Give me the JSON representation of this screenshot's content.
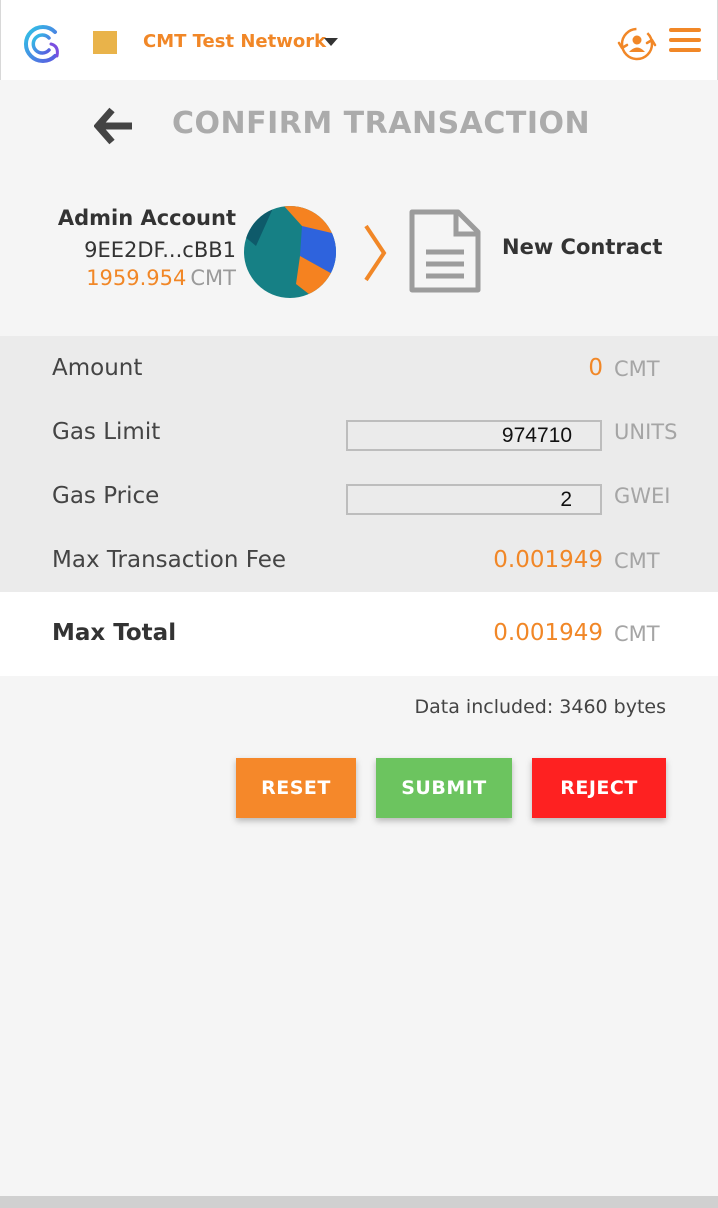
{
  "header": {
    "network_name": "CMT Test Network",
    "network_color": "#e9b34a",
    "accent": "#f18727"
  },
  "page": {
    "title": "CONFIRM TRANSACTION"
  },
  "sender": {
    "name": "Admin Account",
    "address": "9EE2DF...cBB1",
    "balance": "1959.954",
    "balance_unit": "CMT"
  },
  "recipient": {
    "label": "New Contract"
  },
  "details": {
    "amount_label": "Amount",
    "amount_value": "0",
    "amount_unit": "CMT",
    "gas_limit_label": "Gas Limit",
    "gas_limit_value": "974710",
    "gas_limit_unit": "UNITS",
    "gas_price_label": "Gas Price",
    "gas_price_value": "2",
    "gas_price_unit": "GWEI",
    "max_fee_label": "Max Transaction Fee",
    "max_fee_value": "0.001949",
    "max_fee_unit": "CMT"
  },
  "total": {
    "label": "Max Total",
    "value": "0.001949",
    "unit": "CMT"
  },
  "data_note": "Data included: 3460 bytes",
  "actions": {
    "reset": "RESET",
    "submit": "SUBMIT",
    "reject": "REJECT"
  },
  "icons": {
    "logo": "cmt-logo-icon",
    "account": "account-switch-icon",
    "menu": "hamburger-menu-icon",
    "back": "back-arrow-icon",
    "chevron": "chevron-right-icon",
    "document": "document-icon"
  }
}
